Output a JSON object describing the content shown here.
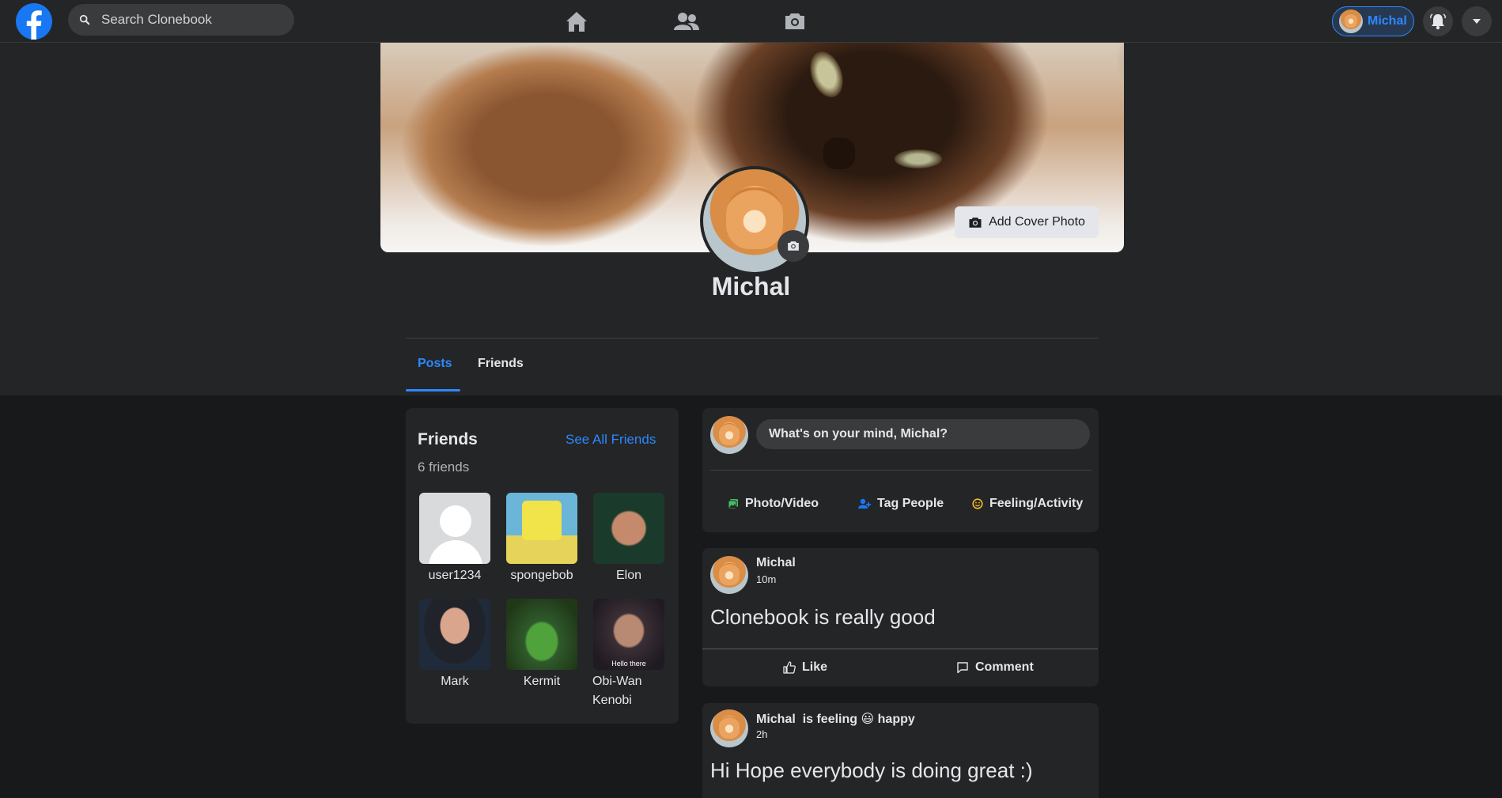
{
  "topbar": {
    "search_placeholder": "Search Clonebook",
    "profile_chip_name": "Michal"
  },
  "profile": {
    "add_cover_label": "Add Cover Photo",
    "name": "Michal",
    "tabs": [
      {
        "label": "Posts",
        "active": true
      },
      {
        "label": "Friends",
        "active": false
      }
    ]
  },
  "friends_card": {
    "title": "Friends",
    "see_all": "See All Friends",
    "count": "6 friends",
    "friends": [
      {
        "name": "user1234"
      },
      {
        "name": "spongebob"
      },
      {
        "name": "Elon"
      },
      {
        "name": "Mark"
      },
      {
        "name": "Kermit"
      },
      {
        "name": "Obi-Wan Kenobi",
        "image_caption": "Hello there"
      }
    ]
  },
  "composer": {
    "placeholder": "What's on your mind, Michal?",
    "actions": [
      "Photo/Video",
      "Tag People",
      "Feeling/Activity"
    ]
  },
  "posts": [
    {
      "author": "Michal",
      "time": "10m",
      "text": "Clonebook is really good",
      "like": "Like",
      "comment": "Comment"
    },
    {
      "author": "Michal",
      "feeling_prefix": "is feeling",
      "feeling_emoji": "😃",
      "feeling": "happy",
      "time": "2h",
      "text": "Hi Hope everybody is doing great :)"
    }
  ],
  "colors": {
    "accent": "#2d88ff",
    "brand": "#1877f2",
    "page_bg": "#18191a",
    "card_bg": "#242526"
  },
  "icons": [
    "facebook-logo-icon",
    "search-icon",
    "home-icon",
    "friends-icon",
    "camera-icon",
    "bell-icon",
    "caret-down-icon",
    "photo-icon",
    "tag-people-icon",
    "smiley-icon",
    "like-icon",
    "comment-icon"
  ]
}
